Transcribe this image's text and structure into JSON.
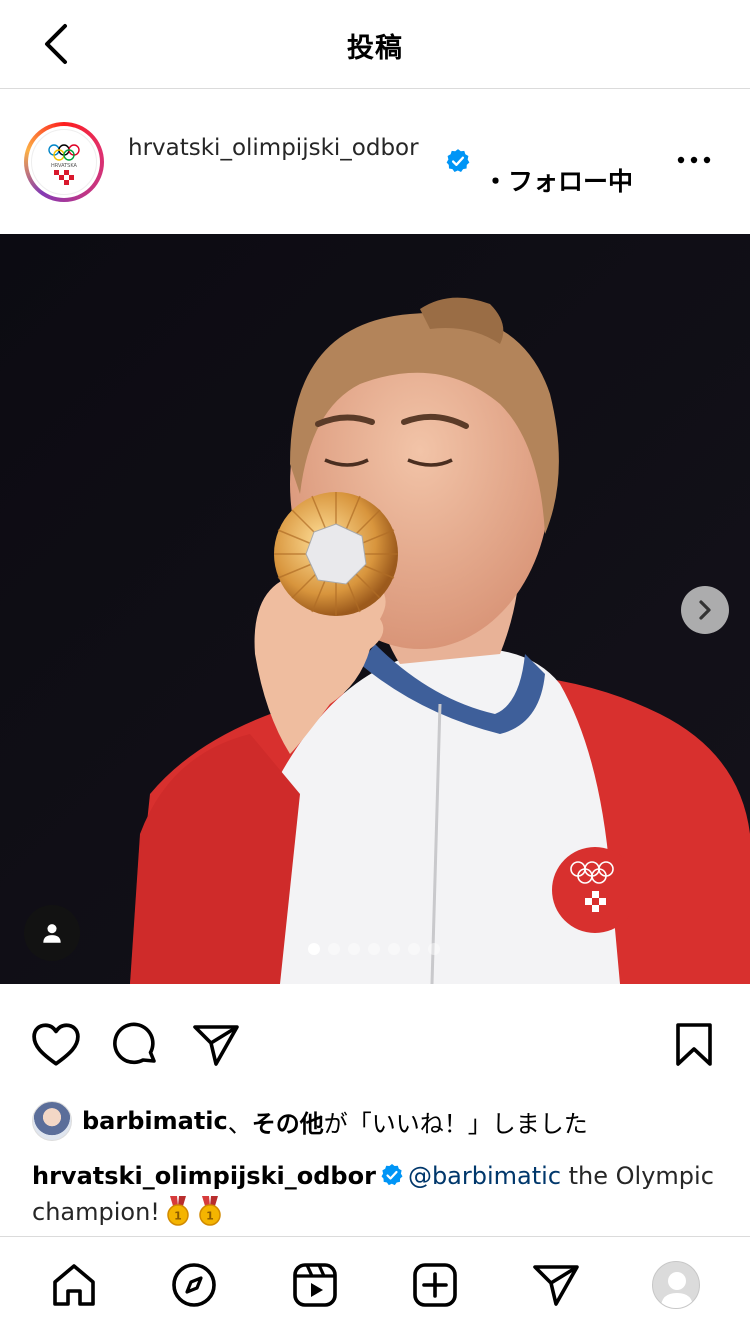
{
  "header": {
    "title": "投稿"
  },
  "post": {
    "username": "hrvatski_olimpijski_odbor",
    "follow_text": "・フォロー中",
    "avatar_text": "HRVATSKA",
    "image_alt": "Athlete kissing gold medal",
    "slide_count": 7,
    "active_slide": 0
  },
  "likes": {
    "user": "barbimatic",
    "separator": "、",
    "others": "その他",
    "suffix": "が「いいね！」しました"
  },
  "caption": {
    "user": "hrvatski_olimpijski_odbor",
    "mention": "@barbimatic",
    "text": " the Olympic champion!"
  },
  "colors": {
    "verified": "#0095f6",
    "mention": "#00376b",
    "divider": "#dbdbdb"
  }
}
